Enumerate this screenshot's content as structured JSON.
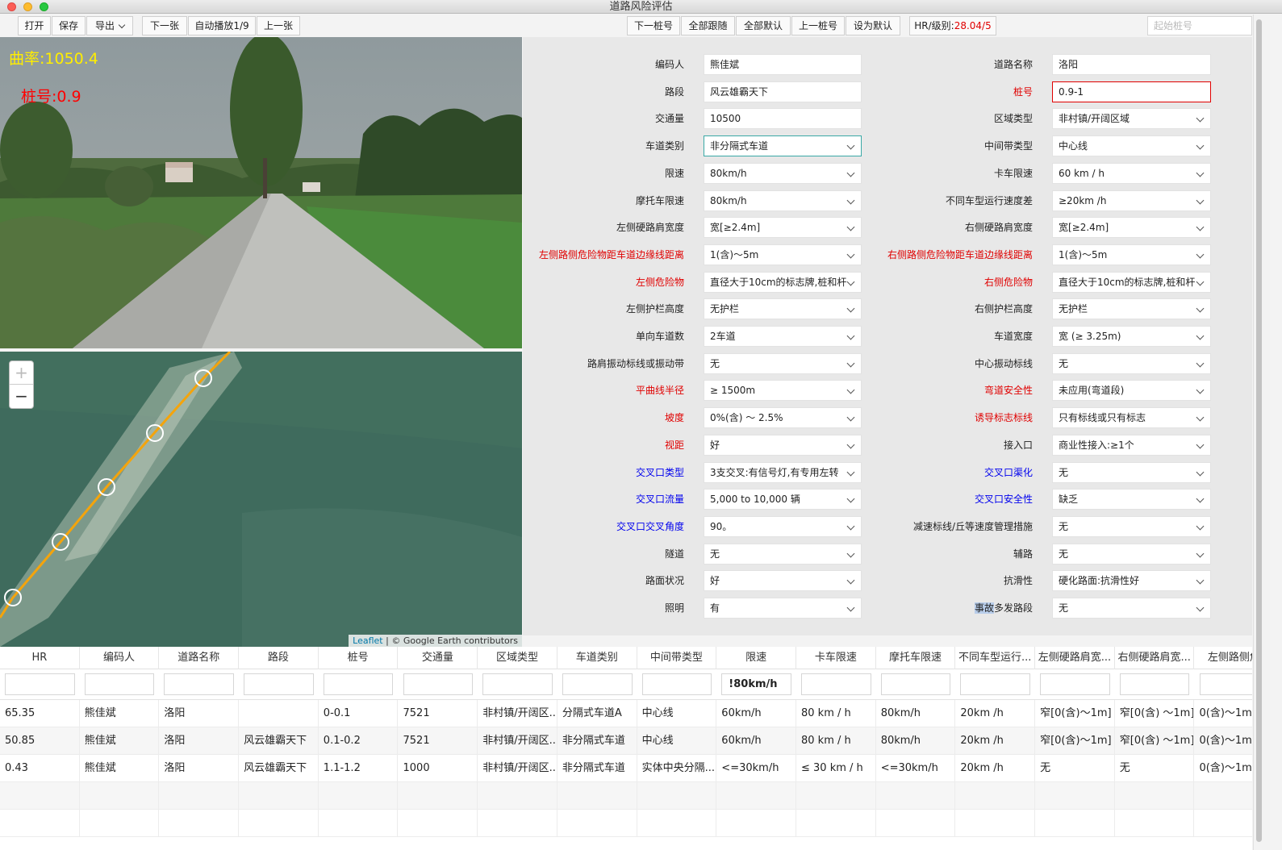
{
  "window": {
    "title": "道路风险评估"
  },
  "toolbar": {
    "open": "打开",
    "save": "保存",
    "export": "导出",
    "next_image": "下一张",
    "autoplay": "自动播放1/9",
    "prev_image": "上一张",
    "next_pile": "下一桩号",
    "follow_all": "全部跟随",
    "default_all": "全部默认",
    "prev_pile": "上一桩号",
    "set_default": "设为默认",
    "hr_label": "HR/级别:",
    "hr_value": "28.04/5",
    "start_pile_placeholder": "起始桩号"
  },
  "photo": {
    "curvature": "曲率:1050.4",
    "pile": "桩号:0.9"
  },
  "map": {
    "zoom_in": "+",
    "zoom_out": "−",
    "attribution_link": "Leaflet",
    "attribution_text": " | © Google Earth contributors"
  },
  "form": {
    "left": [
      {
        "label": "编码人",
        "value": "熊佳斌",
        "type": "text",
        "color": "black"
      },
      {
        "label": "路段",
        "value": "风云雄霸天下",
        "type": "text",
        "color": "black"
      },
      {
        "label": "交通量",
        "value": "10500",
        "type": "text",
        "color": "black"
      },
      {
        "label": "车道类别",
        "value": "非分隔式车道",
        "type": "select",
        "color": "black",
        "state": "active"
      },
      {
        "label": "限速",
        "value": "80km/h",
        "type": "select",
        "color": "black"
      },
      {
        "label": "摩托车限速",
        "value": "80km/h",
        "type": "select",
        "color": "black"
      },
      {
        "label": "左侧硬路肩宽度",
        "value": "宽[≥2.4m]",
        "type": "select",
        "color": "black"
      },
      {
        "label": "左侧路侧危险物距车道边缘线距离",
        "value": "1(含)～5m",
        "type": "select",
        "color": "red"
      },
      {
        "label": "左侧危险物",
        "value": "直径大于10cm的标志牌,桩和杆",
        "type": "select",
        "color": "red"
      },
      {
        "label": "左侧护栏高度",
        "value": "无护栏",
        "type": "select",
        "color": "black"
      },
      {
        "label": "单向车道数",
        "value": "2车道",
        "type": "select",
        "color": "black"
      },
      {
        "label": "路肩振动标线或振动带",
        "value": "无",
        "type": "select",
        "color": "black"
      },
      {
        "label": "平曲线半径",
        "value": "≥ 1500m",
        "type": "select",
        "color": "red"
      },
      {
        "label": "坡度",
        "value": "0%(含) ～ 2.5%",
        "type": "select",
        "color": "red"
      },
      {
        "label": "视距",
        "value": "好",
        "type": "select",
        "color": "red"
      },
      {
        "label": "交叉口类型",
        "value": "3支交叉:有信号灯,有专用左转",
        "type": "select",
        "color": "blue"
      },
      {
        "label": "交叉口流量",
        "value": "5,000 to 10,000 辆",
        "type": "select",
        "color": "blue"
      },
      {
        "label": "交叉口交叉角度",
        "value": "90。",
        "type": "select",
        "color": "blue"
      },
      {
        "label": "隧道",
        "value": "无",
        "type": "select",
        "color": "black"
      },
      {
        "label": "路面状况",
        "value": "好",
        "type": "select",
        "color": "black"
      },
      {
        "label": "照明",
        "value": "有",
        "type": "select",
        "color": "black"
      }
    ],
    "right": [
      {
        "label": "道路名称",
        "value": "洛阳",
        "type": "text",
        "color": "black"
      },
      {
        "label": "桩号",
        "value": "0.9-1",
        "type": "text",
        "color": "red",
        "state": "error"
      },
      {
        "label": "区域类型",
        "value": "非村镇/开阔区域",
        "type": "select",
        "color": "black"
      },
      {
        "label": "中间带类型",
        "value": "中心线",
        "type": "select",
        "color": "black"
      },
      {
        "label": "卡车限速",
        "value": "60 km / h",
        "type": "select",
        "color": "black"
      },
      {
        "label": "不同车型运行速度差",
        "value": "≥20km /h",
        "type": "select",
        "color": "black"
      },
      {
        "label": "右侧硬路肩宽度",
        "value": "宽[≥2.4m]",
        "type": "select",
        "color": "black"
      },
      {
        "label": "右侧路侧危险物距车道边缘线距离",
        "value": "1(含)～5m",
        "type": "select",
        "color": "red"
      },
      {
        "label": "右侧危险物",
        "value": "直径大于10cm的标志牌,桩和杆",
        "type": "select",
        "color": "red"
      },
      {
        "label": "右侧护栏高度",
        "value": "无护栏",
        "type": "select",
        "color": "black"
      },
      {
        "label": "车道宽度",
        "value": "宽 (≥ 3.25m)",
        "type": "select",
        "color": "black"
      },
      {
        "label": "中心振动标线",
        "value": "无",
        "type": "select",
        "color": "black"
      },
      {
        "label": "弯道安全性",
        "value": "未应用(弯道段)",
        "type": "select",
        "color": "red"
      },
      {
        "label": "诱导标志标线",
        "value": "只有标线或只有标志",
        "type": "select",
        "color": "red"
      },
      {
        "label": "接入口",
        "value": "商业性接入:≥1个",
        "type": "select",
        "color": "black"
      },
      {
        "label": "交叉口渠化",
        "value": "无",
        "type": "select",
        "color": "blue"
      },
      {
        "label": "交叉口安全性",
        "value": "缺乏",
        "type": "select",
        "color": "blue"
      },
      {
        "label": "减速标线/丘等速度管理措施",
        "value": "无",
        "type": "select",
        "color": "black"
      },
      {
        "label": "辅路",
        "value": "无",
        "type": "select",
        "color": "black"
      },
      {
        "label": "抗滑性",
        "value": "硬化路面:抗滑性好",
        "type": "select",
        "color": "black"
      },
      {
        "label": "事故多发路段",
        "label_highlight": "事故",
        "label_rest": "多发路段",
        "value": "无",
        "type": "select",
        "color": "black"
      }
    ]
  },
  "grid": {
    "columns": [
      "HR",
      "编码人",
      "道路名称",
      "路段",
      "桩号",
      "交通量",
      "区域类型",
      "车道类别",
      "中间带类型",
      "限速",
      "卡车限速",
      "摩托车限速",
      "不同车型运行...",
      "左侧硬路肩宽...",
      "右侧硬路肩宽...",
      "左侧路侧危"
    ],
    "filter_speed": "!80km/h",
    "rows": [
      [
        "65.35",
        "熊佳斌",
        "洛阳",
        "",
        "0-0.1",
        "7521",
        "非村镇/开阔区...",
        "分隔式车道A",
        "中心线",
        "60km/h",
        "80 km / h",
        "80km/h",
        "20km /h",
        "窄[0(含)～1m]",
        "窄[0(含) ～1m]",
        "0(含)～1m"
      ],
      [
        "50.85",
        "熊佳斌",
        "洛阳",
        "风云雄霸天下",
        "0.1-0.2",
        "7521",
        "非村镇/开阔区...",
        "非分隔式车道",
        "中心线",
        "60km/h",
        "80 km / h",
        "80km/h",
        "20km /h",
        "窄[0(含)～1m]",
        "窄[0(含) ～1m]",
        "0(含)～1m"
      ],
      [
        "0.43",
        "熊佳斌",
        "洛阳",
        "风云雄霸天下",
        "1.1-1.2",
        "1000",
        "非村镇/开阔区...",
        "非分隔式车道",
        "实体中央分隔...",
        "<=30km/h",
        "≤ 30 km / h",
        "<=30km/h",
        "20km /h",
        "无",
        "无",
        "0(含)～1m"
      ]
    ]
  }
}
